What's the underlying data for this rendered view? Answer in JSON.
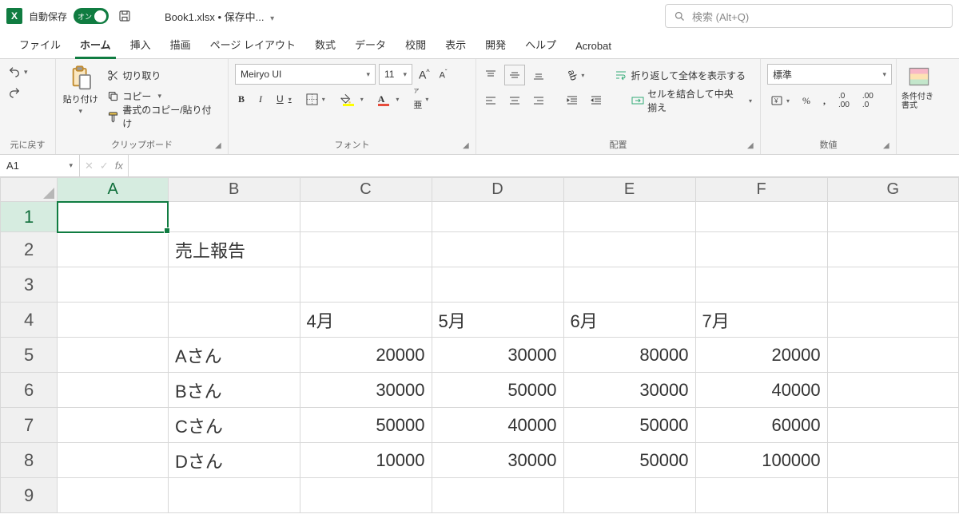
{
  "titlebar": {
    "autosave_label": "自動保存",
    "autosave_on": "オン",
    "document_title": "Book1.xlsx • 保存中...",
    "search_placeholder": "検索 (Alt+Q)"
  },
  "tabs": {
    "file": "ファイル",
    "home": "ホーム",
    "insert": "挿入",
    "draw": "描画",
    "page_layout": "ページ レイアウト",
    "formulas": "数式",
    "data": "データ",
    "review": "校閲",
    "view": "表示",
    "developer": "開発",
    "help": "ヘルプ",
    "acrobat": "Acrobat"
  },
  "ribbon": {
    "undo_group": "元に戻す",
    "clipboard": {
      "paste": "貼り付け",
      "cut": "切り取り",
      "copy": "コピー",
      "format_painter": "書式のコピー/貼り付け",
      "label": "クリップボード"
    },
    "font": {
      "name": "Meiryo UI",
      "size": "11",
      "bold": "B",
      "italic": "I",
      "underline": "U",
      "label": "フォント"
    },
    "alignment": {
      "wrap": "折り返して全体を表示する",
      "merge": "セルを結合して中央揃え",
      "label": "配置"
    },
    "number": {
      "format": "標準",
      "percent": "%",
      "comma": ",",
      "label": "数値"
    },
    "styles": {
      "conditional": "条件付き書式"
    }
  },
  "formula_bar": {
    "name_box": "A1",
    "fx": "fx"
  },
  "sheet": {
    "columns": [
      "A",
      "B",
      "C",
      "D",
      "E",
      "F",
      "G"
    ],
    "rows": [
      "1",
      "2",
      "3",
      "4",
      "5",
      "6",
      "7",
      "8",
      "9"
    ],
    "selected_cell": "A1",
    "B2": "売上報告",
    "C4": "4月",
    "D4": "5月",
    "E4": "6月",
    "F4": "7月",
    "B5": "Aさん",
    "C5": "20000",
    "D5": "30000",
    "E5": "80000",
    "F5": "20000",
    "B6": "Bさん",
    "C6": "30000",
    "D6": "50000",
    "E6": "30000",
    "F6": "40000",
    "B7": "Cさん",
    "C7": "50000",
    "D7": "40000",
    "E7": "50000",
    "F7": "60000",
    "B8": "Dさん",
    "C8": "10000",
    "D8": "30000",
    "E8": "50000",
    "F8": "100000"
  },
  "chart_data": {
    "type": "table",
    "title": "売上報告",
    "categories": [
      "4月",
      "5月",
      "6月",
      "7月"
    ],
    "series": [
      {
        "name": "Aさん",
        "values": [
          20000,
          30000,
          80000,
          20000
        ]
      },
      {
        "name": "Bさん",
        "values": [
          30000,
          50000,
          30000,
          40000
        ]
      },
      {
        "name": "Cさん",
        "values": [
          50000,
          40000,
          50000,
          60000
        ]
      },
      {
        "name": "Dさん",
        "values": [
          10000,
          30000,
          50000,
          100000
        ]
      }
    ]
  }
}
